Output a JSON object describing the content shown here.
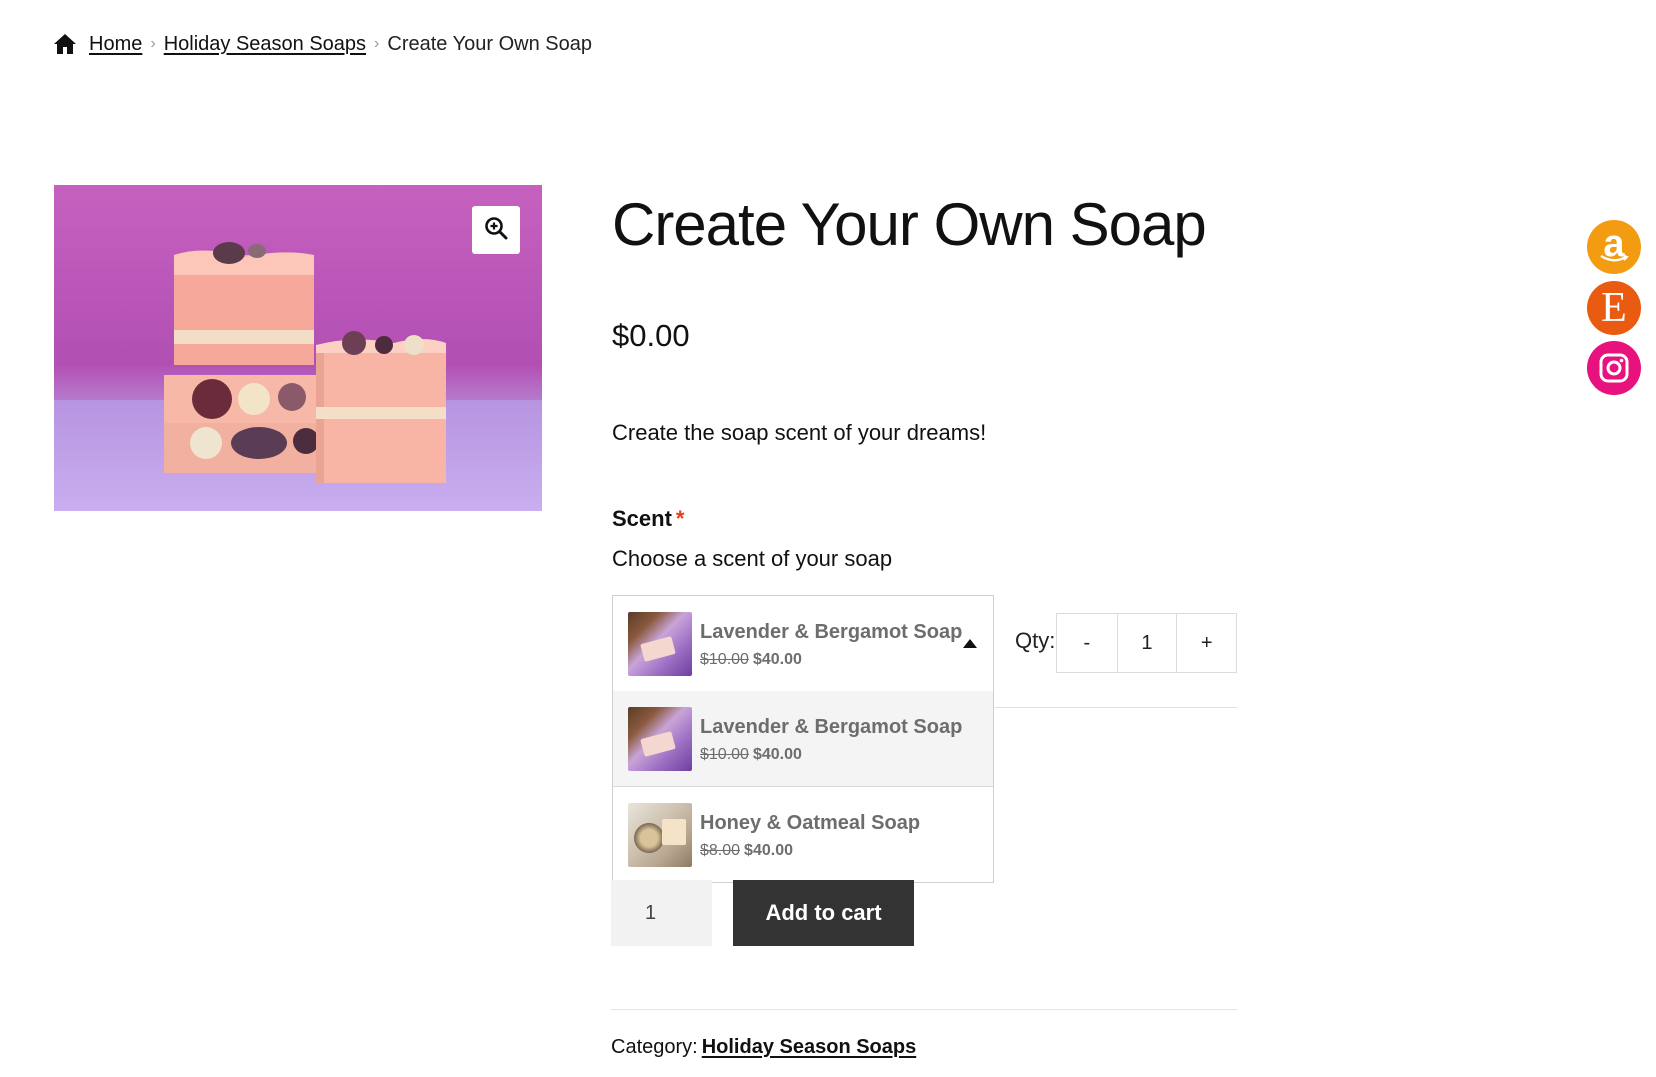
{
  "breadcrumb": {
    "home": "Home",
    "category": "Holiday Season Soaps",
    "current": "Create Your Own Soap",
    "separator": "›"
  },
  "product": {
    "title": "Create Your Own Soap",
    "price": "$0.00",
    "description": "Create the soap scent of your dreams!",
    "zoom_icon": "zoom-in-icon"
  },
  "scent": {
    "label": "Scent",
    "required_mark": "*",
    "help": "Choose a scent of your soap",
    "selected": {
      "name": "Lavender & Bergamot Soap",
      "old_price": "$10.00",
      "price": "$40.00"
    },
    "options": [
      {
        "name": "Lavender & Bergamot Soap",
        "old_price": "$10.00",
        "price": "$40.00"
      },
      {
        "name": "Honey & Oatmeal Soap",
        "old_price": "$8.00",
        "price": "$40.00"
      }
    ]
  },
  "qty": {
    "label": "Qty:",
    "minus": "-",
    "value": "1",
    "plus": "+"
  },
  "cart": {
    "quantity": "1",
    "button": "Add to cart"
  },
  "meta": {
    "category_label": "Category:",
    "category": "Holiday Season Soaps"
  },
  "social": {
    "amazon_glyph": "a",
    "etsy_glyph": "E",
    "icons": [
      "amazon-icon",
      "etsy-icon",
      "instagram-icon"
    ]
  },
  "colors": {
    "accent_dark": "#333333",
    "required": "#e2401c",
    "amazon": "#f39c12",
    "etsy": "#ea5b12",
    "instagram": "#e8127f"
  }
}
